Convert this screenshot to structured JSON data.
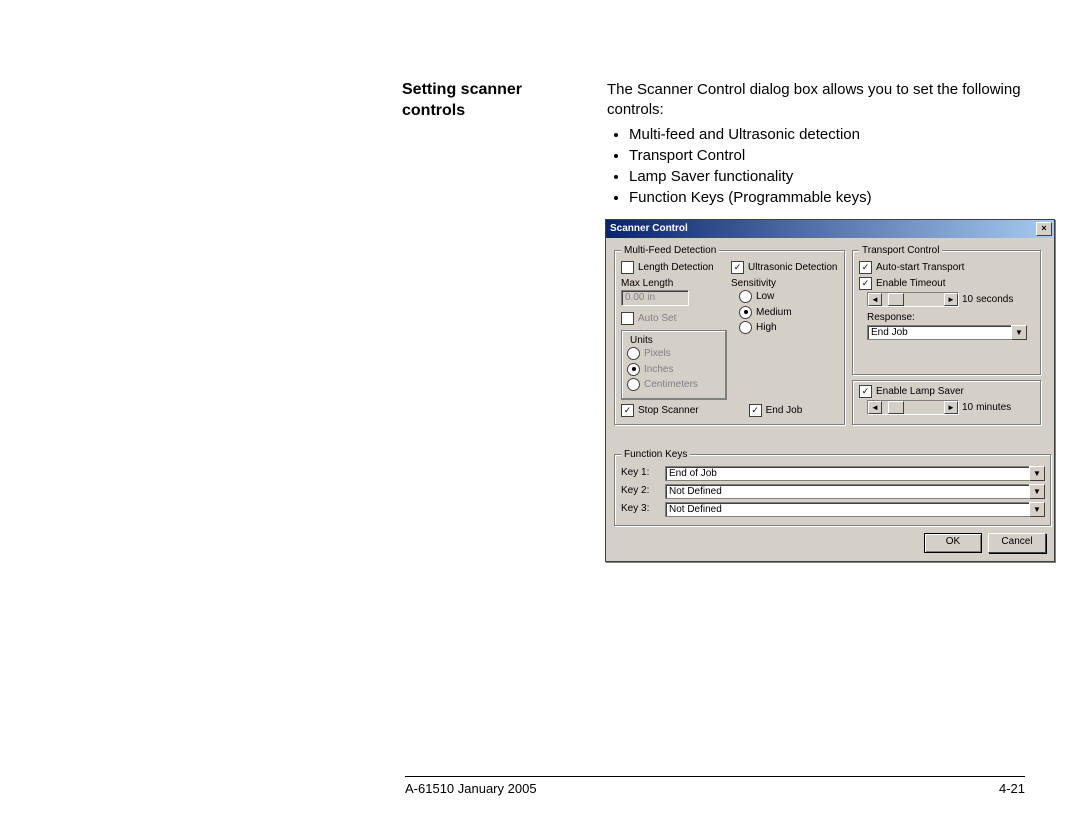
{
  "heading": "Setting scanner controls",
  "intro": "The Scanner Control dialog box allows you to set the following controls:",
  "bullets": [
    "Multi-feed and Ultrasonic detection",
    "Transport Control",
    "Lamp Saver functionality",
    "Function Keys (Programmable keys)"
  ],
  "dialog": {
    "title": "Scanner Control",
    "multifeed": {
      "legend": "Multi-Feed Detection",
      "lengthDetection": "Length Detection",
      "maxLength": "Max Length",
      "maxLengthValue": "0.00 in",
      "autoSet": "Auto Set",
      "unitsLegend": "Units",
      "units": {
        "pixels": "Pixels",
        "inches": "Inches",
        "centimeters": "Centimeters"
      },
      "ultrasonic": "Ultrasonic Detection",
      "sensitivity": "Sensitivity",
      "sens": {
        "low": "Low",
        "medium": "Medium",
        "high": "High"
      },
      "stopScanner": "Stop Scanner",
      "endJob": "End Job"
    },
    "transport": {
      "legend": "Transport Control",
      "autoStart": "Auto-start Transport",
      "enableTimeout": "Enable Timeout",
      "timeoutValue": "10",
      "timeoutUnit": "seconds",
      "responseLabel": "Response:",
      "responseValue": "End Job"
    },
    "lamp": {
      "enable": "Enable Lamp Saver",
      "value": "10",
      "unit": "minutes"
    },
    "functionKeys": {
      "legend": "Function Keys",
      "rows": [
        {
          "label": "Key 1:",
          "value": "End of Job"
        },
        {
          "label": "Key 2:",
          "value": "Not Defined"
        },
        {
          "label": "Key 3:",
          "value": "Not Defined"
        }
      ]
    },
    "buttons": {
      "ok": "OK",
      "cancel": "Cancel"
    }
  },
  "footer": {
    "left": "A-61510 January 2005",
    "right": "4-21"
  }
}
